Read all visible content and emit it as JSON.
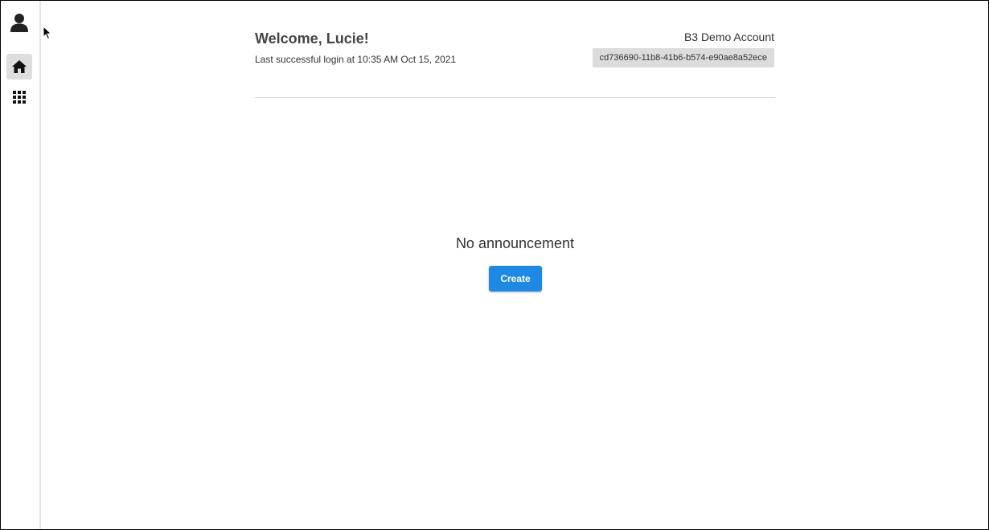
{
  "header": {
    "welcome": "Welcome, Lucie!",
    "last_login": "Last successful login at 10:35 AM Oct 15, 2021",
    "account_name": "B3 Demo Account",
    "account_id": "cd736690-11b8-41b6-b574-e90ae8a52ece"
  },
  "sidebar": {
    "items": [
      {
        "icon": "user-icon"
      },
      {
        "icon": "home-icon",
        "active": true
      },
      {
        "icon": "apps-grid-icon"
      }
    ]
  },
  "main": {
    "empty_message": "No announcement",
    "create_label": "Create"
  },
  "colors": {
    "primary": "#1e88e5",
    "sidebar_active": "#dedede",
    "badge_bg": "#dcdcdc"
  }
}
